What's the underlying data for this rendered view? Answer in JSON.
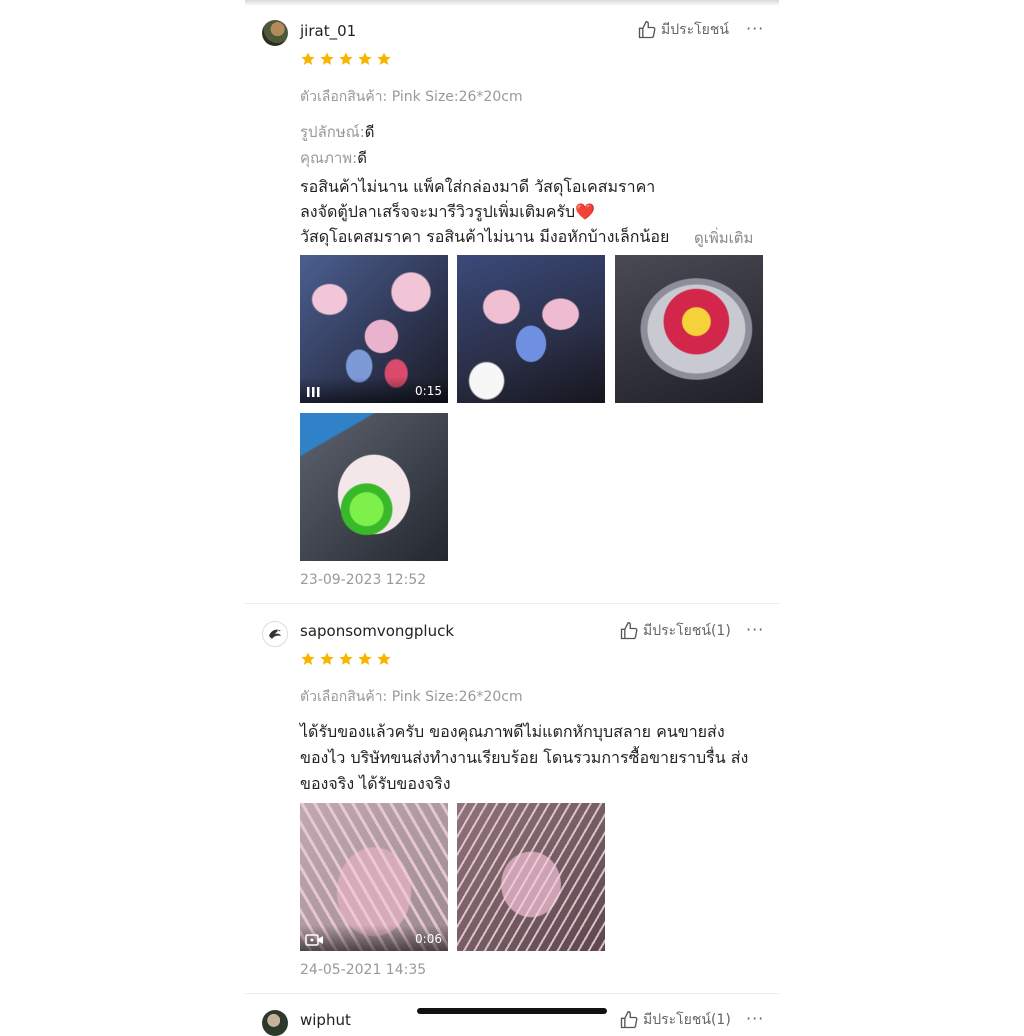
{
  "reviews": [
    {
      "username": "jirat_01",
      "helpful_label": "มีประโยชน์",
      "more_label": "···",
      "rating": 5,
      "variant": "ตัวเลือกสินค้า: Pink Size:26*20cm",
      "attr1_label": "รูปลักษณ์:",
      "attr1_value": "ดี",
      "attr2_label": "คุณภาพ:",
      "attr2_value": "ดี",
      "text_lines": [
        "รอสินค้าไม่นาน แพ็คใส่กล่องมาดี วัสดุโอเคสมราคา",
        "ลงจัดตู้ปลาเสร็จจะมารีวิวรูปเพิ่มเติมครับ❤️",
        "วัสดุโอเคสมราคา รอสินค้าไม่นาน มีงอหักบ้างเล็กน้อย"
      ],
      "see_more": "ดูเพิ่มเติม",
      "video_duration": "0:15",
      "date": "23-09-2023 12:52"
    },
    {
      "username": "saponsomvongpluck",
      "helpful_label": "มีประโยชน์(1)",
      "more_label": "···",
      "rating": 5,
      "variant": "ตัวเลือกสินค้า: Pink Size:26*20cm",
      "text_lines": [
        "ได้รับของแล้วครับ ของคุณภาพดีไม่แตกหักบุบสลาย คนขายส่ง",
        "ของไว บริษัทขนส่งทำงานเรียบร้อย โดนรวมการซื้อขายราบรื่น ส่ง",
        "ของจริง ได้รับของจริง"
      ],
      "video_duration": "0:06",
      "date": "24-05-2021 14:35"
    },
    {
      "username": "wiphut",
      "helpful_label": "มีประโยชน์(1)",
      "more_label": "···"
    }
  ],
  "colors": {
    "star": "#f7b500",
    "muted": "#999999",
    "text": "#222222"
  }
}
